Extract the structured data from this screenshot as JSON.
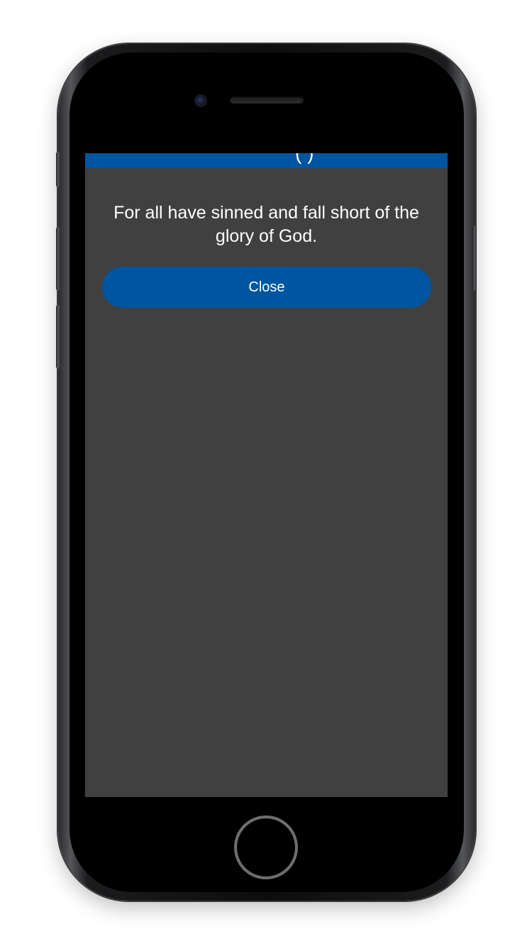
{
  "device": {
    "type": "iphone",
    "icons": {
      "camera": "front-camera-icon",
      "speaker": "earpiece-speaker",
      "home": "home-button"
    }
  },
  "colors": {
    "accent": "#0055a0",
    "background": "#404040",
    "text": "#ffffff"
  },
  "nav": {
    "partial_title": "(   )"
  },
  "dialog": {
    "message": "For all have sinned and fall short of the glory of God.",
    "close_label": "Close"
  }
}
